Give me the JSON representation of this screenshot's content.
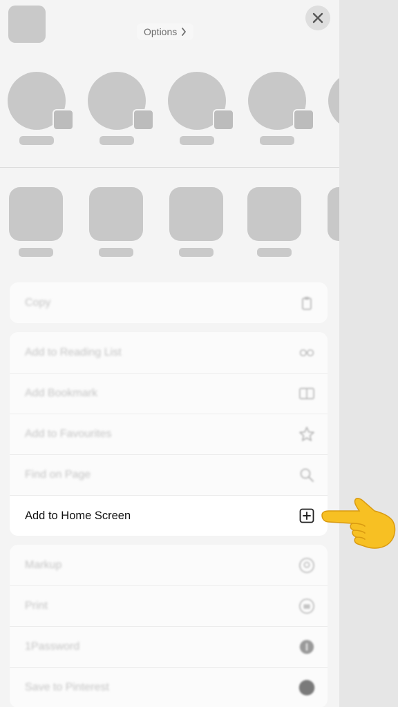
{
  "header": {
    "options_label": "Options"
  },
  "contacts_count": 5,
  "apps_count": 5,
  "menu": {
    "group1": [
      {
        "label": "Copy",
        "icon": "copy-icon"
      }
    ],
    "group2": [
      {
        "label": "Add to Reading List",
        "icon": "glasses-icon"
      },
      {
        "label": "Add Bookmark",
        "icon": "book-icon"
      },
      {
        "label": "Add to Favourites",
        "icon": "star-icon"
      },
      {
        "label": "Find on Page",
        "icon": "magnifier-icon"
      },
      {
        "label": "Add to Home Screen",
        "icon": "plus-square-icon"
      }
    ],
    "group3": [
      {
        "label": "Markup",
        "icon": "markup-icon"
      },
      {
        "label": "Print",
        "icon": "print-icon"
      },
      {
        "label": "1Password",
        "icon": "1password-icon"
      },
      {
        "label": "Save to Pinterest",
        "icon": "pinterest-icon"
      }
    ]
  },
  "colors": {
    "sheet": "#f4f4f4",
    "placeholder": "#c8c8c8",
    "highlight_text": "#111111",
    "pointer": "#f7c023"
  }
}
